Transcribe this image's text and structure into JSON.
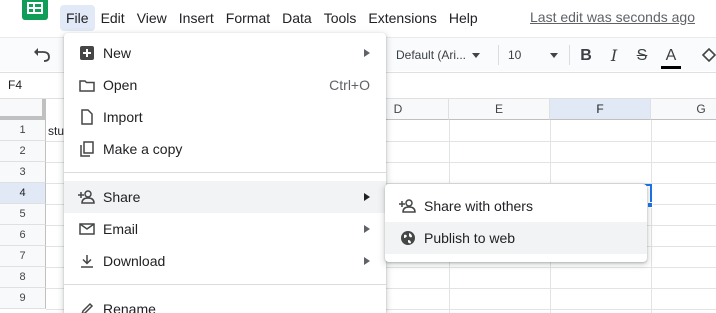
{
  "menubar": {
    "items": [
      "File",
      "Edit",
      "View",
      "Insert",
      "Format",
      "Data",
      "Tools",
      "Extensions",
      "Help"
    ],
    "active_index": 0,
    "last_edit": "Last edit was seconds ago"
  },
  "toolbar": {
    "font": "Default (Ari...",
    "font_size": "10",
    "bold": "B",
    "italic": "I",
    "strikethrough": "S",
    "text_color": "A"
  },
  "namebox": {
    "value": "F4"
  },
  "grid": {
    "column_headers": [
      "D",
      "E",
      "F",
      "G"
    ],
    "selected_column": "F",
    "row_headers": [
      "1",
      "2",
      "3",
      "4",
      "5",
      "6",
      "7",
      "8",
      "9"
    ],
    "selected_row": "4",
    "cell_A1_visible": "stu"
  },
  "file_menu": {
    "items": [
      {
        "label": "New",
        "icon": "new-sheet-icon",
        "shortcut": "",
        "submenu": true
      },
      {
        "label": "Open",
        "icon": "folder-icon",
        "shortcut": "Ctrl+O",
        "submenu": false
      },
      {
        "label": "Import",
        "icon": "file-icon",
        "shortcut": "",
        "submenu": false
      },
      {
        "label": "Make a copy",
        "icon": "copy-icon",
        "shortcut": "",
        "submenu": false
      },
      {
        "label": "Share",
        "icon": "person-add-icon",
        "shortcut": "",
        "submenu": true
      },
      {
        "label": "Email",
        "icon": "mail-icon",
        "shortcut": "",
        "submenu": true
      },
      {
        "label": "Download",
        "icon": "download-icon",
        "shortcut": "",
        "submenu": true
      },
      {
        "label": "Rename",
        "icon": "pencil-icon",
        "shortcut": "",
        "submenu": false
      }
    ],
    "highlighted": "Share"
  },
  "share_submenu": {
    "items": [
      {
        "label": "Share with others",
        "icon": "person-add-icon"
      },
      {
        "label": "Publish to web",
        "icon": "globe-icon"
      }
    ],
    "highlighted": "Publish to web"
  },
  "colors": {
    "accent": "#1a73e8",
    "menu_active_bg": "#e2e9f7",
    "menu_highlight_bg": "#f1f3f4",
    "logo_green": "#0f9d58"
  }
}
